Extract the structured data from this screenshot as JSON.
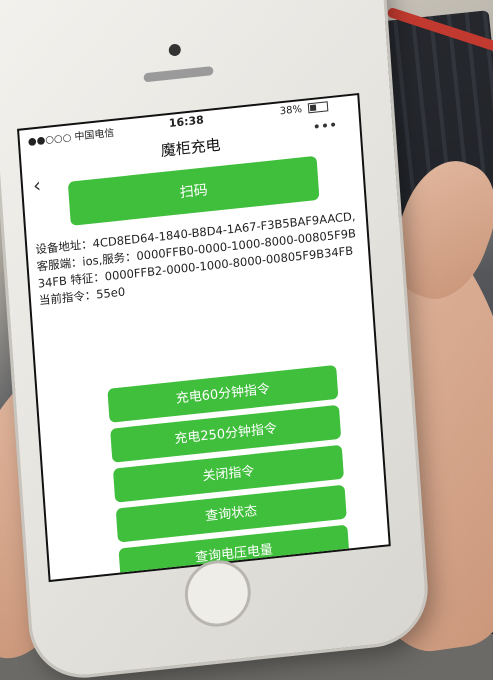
{
  "status_bar": {
    "carrier": "●●○○○ 中国电信",
    "time": "16:38",
    "battery": "38%"
  },
  "nav": {
    "title": "魔柜充电",
    "menu_dots": "•••"
  },
  "scan_button": "扫码",
  "device_info": "设备地址：4CD8ED64-1840-B8D4-1A67-F3B5BAF9AACD,客服端：ios,服务：0000FFB0-0000-1000-8000-00805F9B34FB 特征：0000FFB2-0000-1000-8000-00805F9B34FB当前指令：55e0",
  "commands": [
    "充电60分钟指令",
    "充电250分钟指令",
    "关闭指令",
    "查询状态",
    "查询电压电量"
  ],
  "icons": {
    "back": "chevron-left-icon",
    "battery": "battery-icon"
  },
  "colors": {
    "button_green": "#40bf3c"
  }
}
